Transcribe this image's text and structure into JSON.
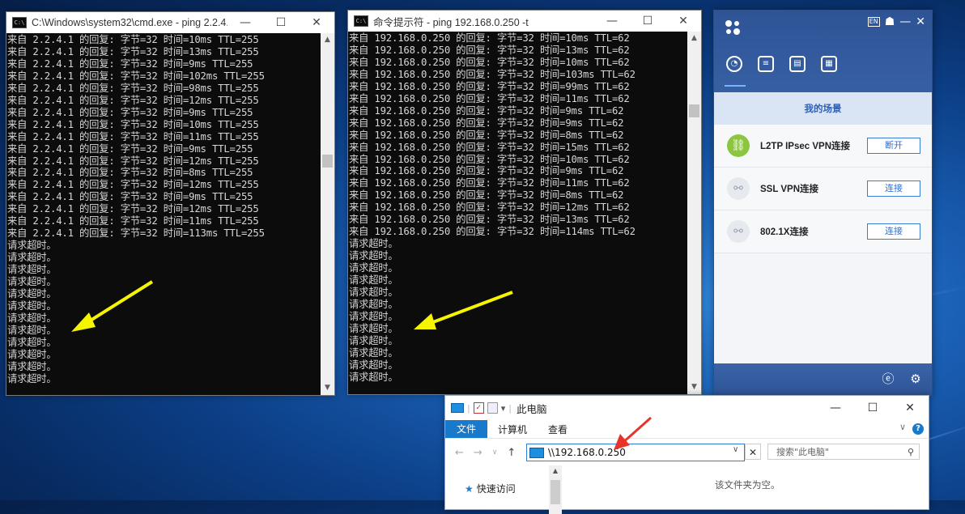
{
  "console1": {
    "title": "C:\\Windows\\system32\\cmd.exe - ping  2.2.4....",
    "lines": [
      "来自 2.2.4.1 的回复: 字节=32 时间=10ms TTL=255",
      "来自 2.2.4.1 的回复: 字节=32 时间=13ms TTL=255",
      "来自 2.2.4.1 的回复: 字节=32 时间=9ms TTL=255",
      "来自 2.2.4.1 的回复: 字节=32 时间=102ms TTL=255",
      "来自 2.2.4.1 的回复: 字节=32 时间=98ms TTL=255",
      "来自 2.2.4.1 的回复: 字节=32 时间=12ms TTL=255",
      "来自 2.2.4.1 的回复: 字节=32 时间=9ms TTL=255",
      "来自 2.2.4.1 的回复: 字节=32 时间=10ms TTL=255",
      "来自 2.2.4.1 的回复: 字节=32 时间=11ms TTL=255",
      "来自 2.2.4.1 的回复: 字节=32 时间=9ms TTL=255",
      "来自 2.2.4.1 的回复: 字节=32 时间=12ms TTL=255",
      "来自 2.2.4.1 的回复: 字节=32 时间=8ms TTL=255",
      "来自 2.2.4.1 的回复: 字节=32 时间=12ms TTL=255",
      "来自 2.2.4.1 的回复: 字节=32 时间=9ms TTL=255",
      "来自 2.2.4.1 的回复: 字节=32 时间=12ms TTL=255",
      "来自 2.2.4.1 的回复: 字节=32 时间=11ms TTL=255",
      "来自 2.2.4.1 的回复: 字节=32 时间=113ms TTL=255",
      "请求超时。",
      "请求超时。",
      "请求超时。",
      "请求超时。",
      "请求超时。",
      "请求超时。",
      "请求超时。",
      "请求超时。",
      "请求超时。",
      "请求超时。",
      "请求超时。",
      "请求超时。"
    ]
  },
  "console2": {
    "title": "命令提示符 - ping  192.168.0.250 -t",
    "lines": [
      "来自 192.168.0.250 的回复: 字节=32 时间=10ms TTL=62",
      "来自 192.168.0.250 的回复: 字节=32 时间=13ms TTL=62",
      "来自 192.168.0.250 的回复: 字节=32 时间=10ms TTL=62",
      "来自 192.168.0.250 的回复: 字节=32 时间=103ms TTL=62",
      "来自 192.168.0.250 的回复: 字节=32 时间=99ms TTL=62",
      "来自 192.168.0.250 的回复: 字节=32 时间=11ms TTL=62",
      "来自 192.168.0.250 的回复: 字节=32 时间=9ms TTL=62",
      "来自 192.168.0.250 的回复: 字节=32 时间=9ms TTL=62",
      "来自 192.168.0.250 的回复: 字节=32 时间=8ms TTL=62",
      "来自 192.168.0.250 的回复: 字节=32 时间=15ms TTL=62",
      "来自 192.168.0.250 的回复: 字节=32 时间=10ms TTL=62",
      "来自 192.168.0.250 的回复: 字节=32 时间=9ms TTL=62",
      "来自 192.168.0.250 的回复: 字节=32 时间=11ms TTL=62",
      "来自 192.168.0.250 的回复: 字节=32 时间=8ms TTL=62",
      "来自 192.168.0.250 的回复: 字节=32 时间=12ms TTL=62",
      "来自 192.168.0.250 的回复: 字节=32 时间=13ms TTL=62",
      "来自 192.168.0.250 的回复: 字节=32 时间=114ms TTL=62",
      "请求超时。",
      "请求超时。",
      "请求超时。",
      "请求超时。",
      "请求超时。",
      "请求超时。",
      "请求超时。",
      "请求超时。",
      "请求超时。",
      "请求超时。",
      "请求超时。",
      "请求超时。"
    ]
  },
  "window_controls": {
    "minimize": "—",
    "maximize": "☐",
    "close": "✕"
  },
  "vpn": {
    "scene_title": "我的场景",
    "lang_badge": "EN",
    "connections": [
      {
        "label": "L2TP IPsec VPN连接",
        "button": "断开",
        "connected": true
      },
      {
        "label": "SSL VPN连接",
        "button": "连接",
        "connected": false
      },
      {
        "label": "802.1X连接",
        "button": "连接",
        "connected": false
      }
    ],
    "accent": "#2e5496",
    "connected_color": "#8cc63f"
  },
  "explorer": {
    "title": "此电脑",
    "ribbon_tabs": [
      "文件",
      "计算机",
      "查看"
    ],
    "address": "\\\\192.168.0.250",
    "search_placeholder": "搜索\"此电脑\"",
    "quick_access": "快速访问",
    "empty_message": "该文件夹为空。",
    "help": "?"
  },
  "annotation_color": "#f5f500"
}
